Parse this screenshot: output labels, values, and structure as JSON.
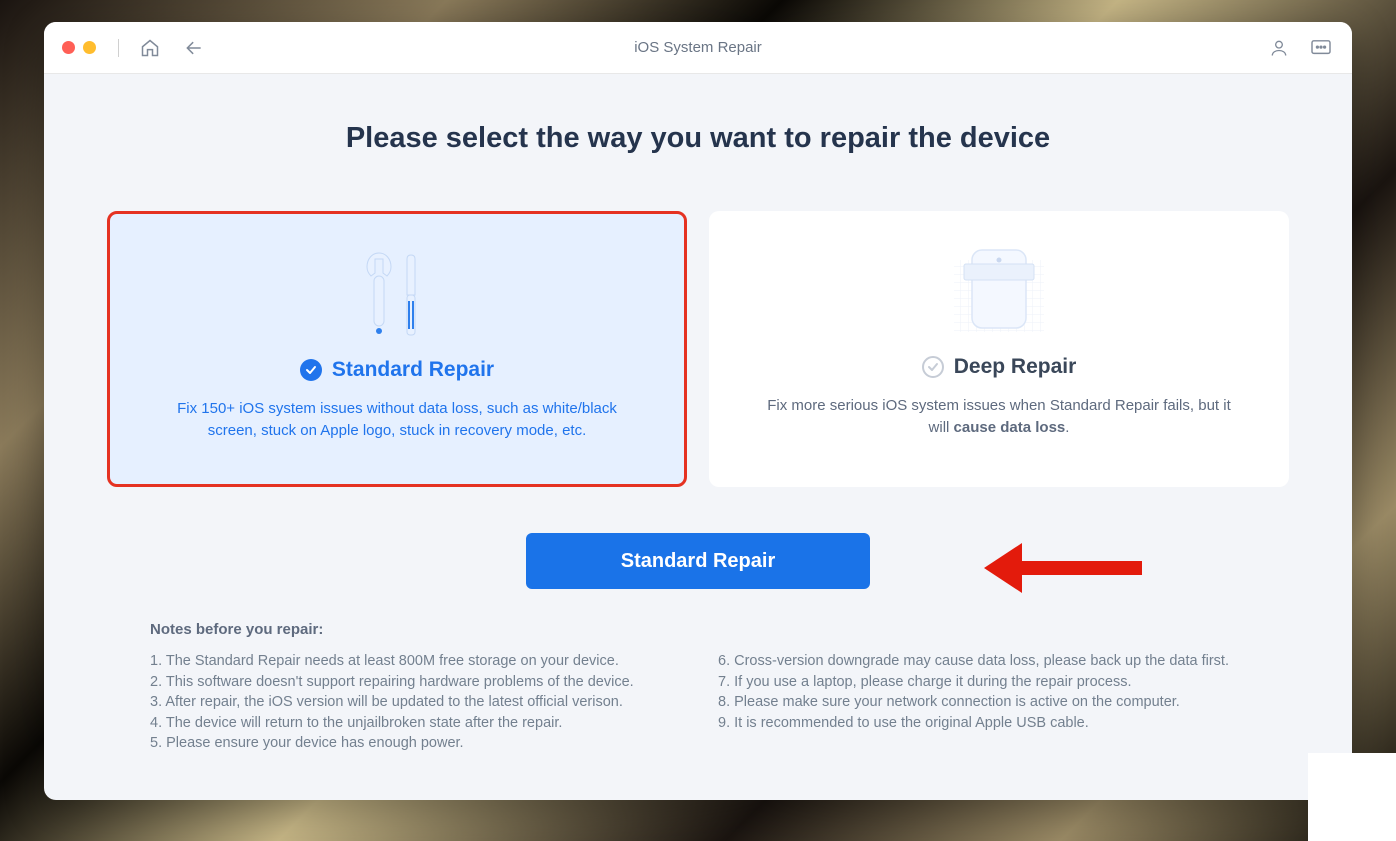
{
  "header": {
    "title": "iOS System Repair"
  },
  "main": {
    "headline": "Please select the way you want to repair the device",
    "cards": {
      "standard": {
        "title": "Standard Repair",
        "description": "Fix 150+ iOS system issues without data loss, such as white/black screen, stuck on Apple logo, stuck in recovery mode, etc."
      },
      "deep": {
        "title": "Deep Repair",
        "desc_before": "Fix more serious iOS system issues when Standard Repair fails, but it will ",
        "desc_bold": "cause data loss",
        "desc_after": "."
      }
    },
    "primary_button": "Standard Repair"
  },
  "notes": {
    "title": "Notes before you repair:",
    "left": [
      "1. The Standard Repair needs at least 800M free storage on your device.",
      "2. This software doesn't support repairing hardware problems of the device.",
      "3. After repair, the iOS version will be updated to the latest official verison.",
      "4. The device will return to the unjailbroken state after the repair.",
      "5. Please ensure your device has enough power."
    ],
    "right": [
      "6. Cross-version downgrade may cause data loss, please back up the data first.",
      "7. If you use a laptop, please charge it during the repair process.",
      "8. Please make sure your network connection is active on the computer.",
      "9. It is recommended to use the original Apple USB cable."
    ]
  }
}
